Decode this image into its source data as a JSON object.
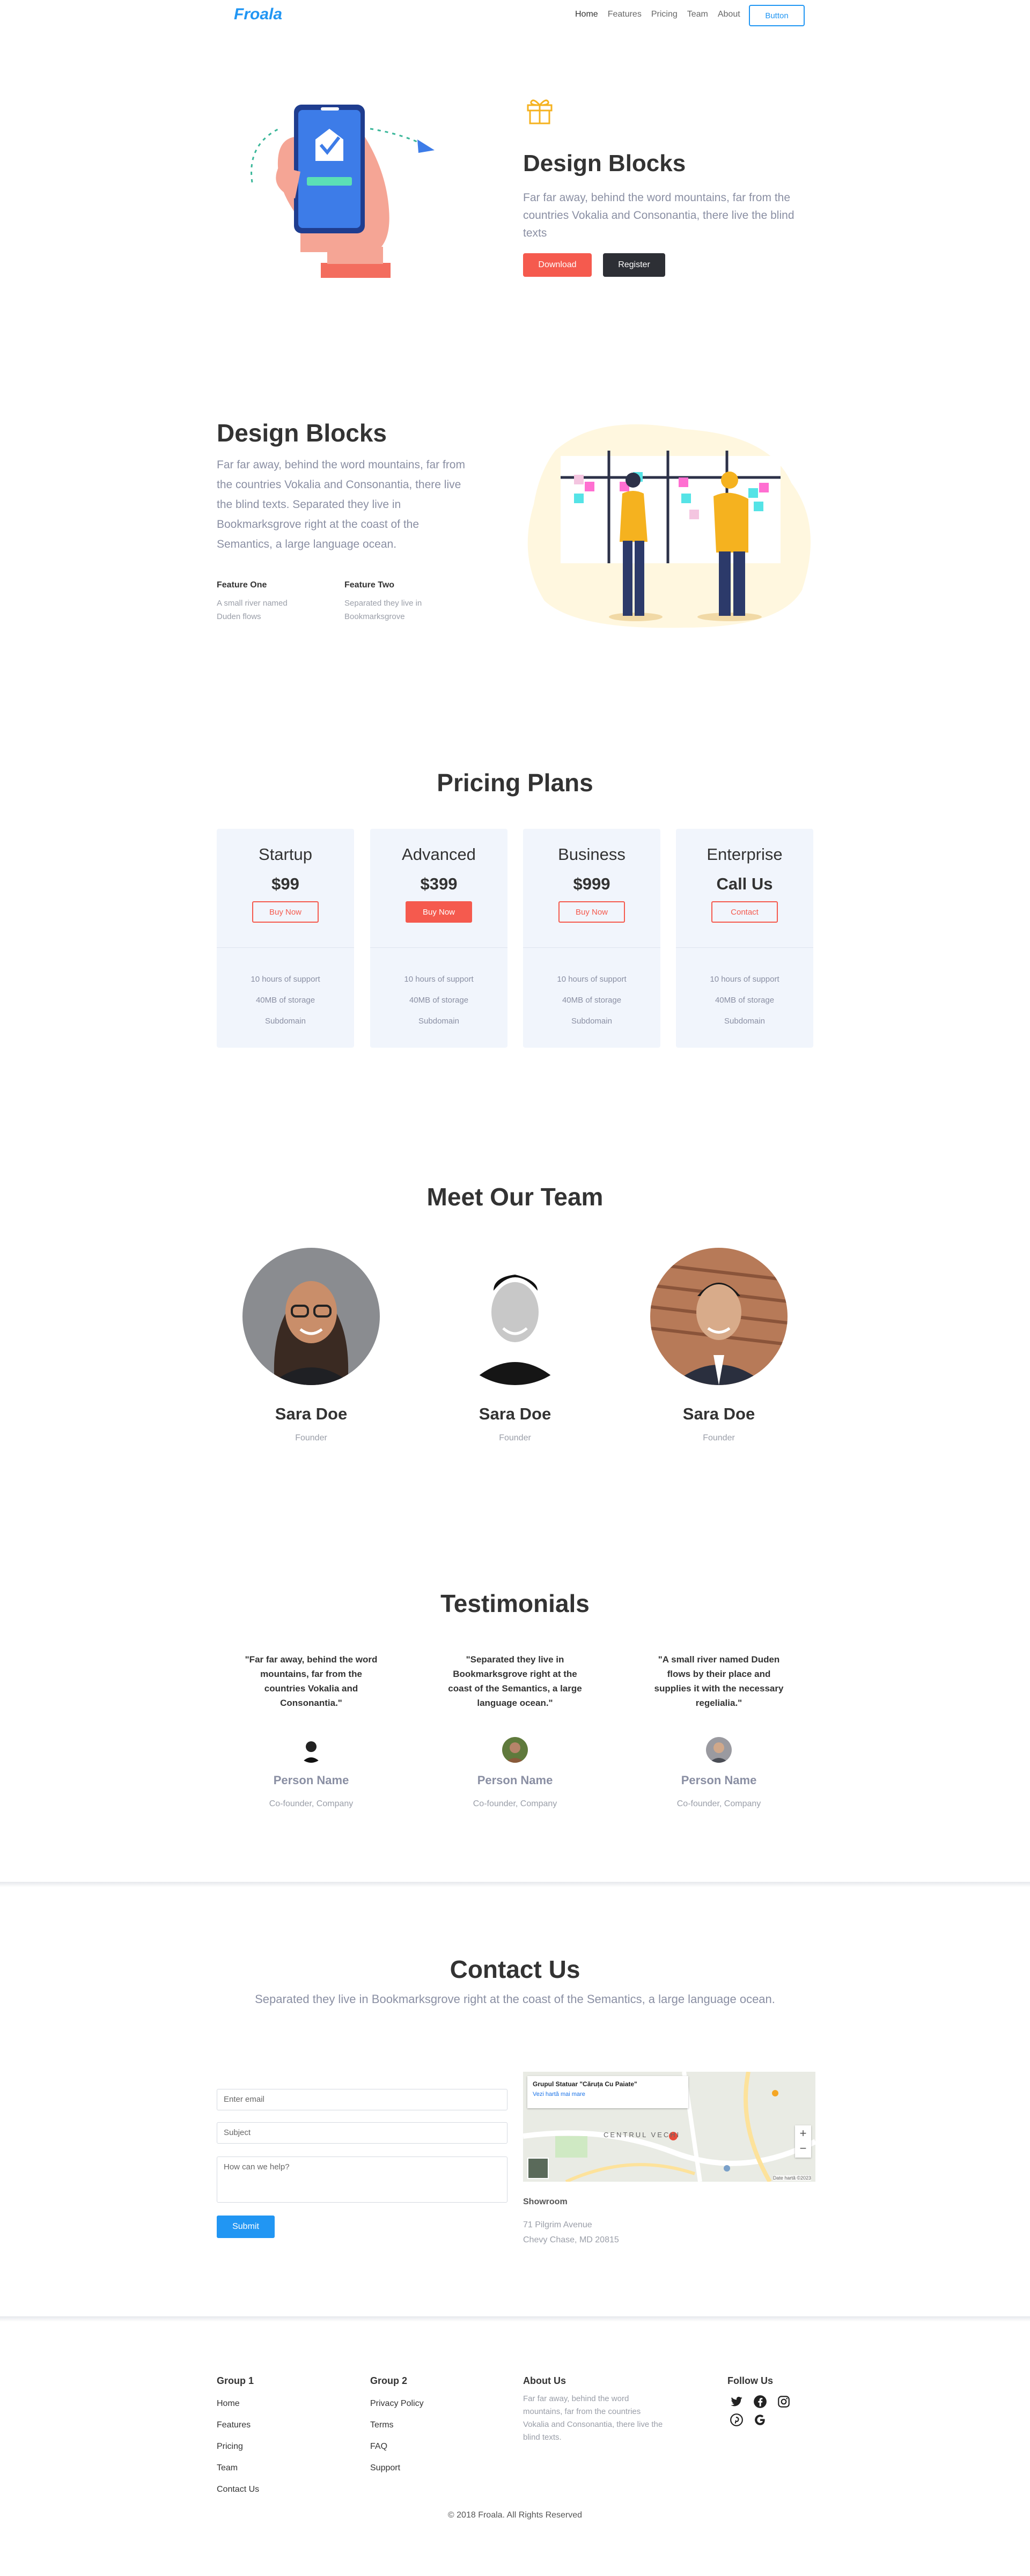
{
  "nav": {
    "logo": "Froala",
    "links": [
      "Home",
      "Features",
      "Pricing",
      "Team",
      "About"
    ],
    "button": "Button"
  },
  "hero": {
    "title": "Design Blocks",
    "text": "Far far away, behind the word mountains, far from the countries Vokalia and Consonantia, there live the blind texts",
    "download": "Download",
    "register": "Register"
  },
  "features": {
    "title": "Design Blocks",
    "text": "Far far away, behind the word mountains, far from the countries Vokalia and Consonantia, there live the blind texts. Separated they live in Bookmarksgrove right at the coast of the Semantics, a large language ocean.",
    "items": [
      {
        "title": "Feature One",
        "text": "A small river named Duden flows"
      },
      {
        "title": "Feature Two",
        "text": "Separated they live in Bookmarksgrove"
      }
    ]
  },
  "pricing": {
    "title": "Pricing Plans",
    "plans": [
      {
        "name": "Startup",
        "price": "$99",
        "button": "Buy Now",
        "features": [
          "10 hours of support",
          "40MB of storage",
          "Subdomain"
        ]
      },
      {
        "name": "Advanced",
        "price": "$399",
        "button": "Buy Now",
        "features": [
          "10 hours of support",
          "40MB of storage",
          "Subdomain"
        ]
      },
      {
        "name": "Business",
        "price": "$999",
        "button": "Buy Now",
        "features": [
          "10 hours of support",
          "40MB of storage",
          "Subdomain"
        ]
      },
      {
        "name": "Enterprise",
        "price": "Call Us",
        "button": "Contact",
        "features": [
          "10 hours of support",
          "40MB of storage",
          "Subdomain"
        ]
      }
    ]
  },
  "team": {
    "title": "Meet Our Team",
    "members": [
      {
        "name": "Sara Doe",
        "role": "Founder"
      },
      {
        "name": "Sara Doe",
        "role": "Founder"
      },
      {
        "name": "Sara Doe",
        "role": "Founder"
      }
    ]
  },
  "testimonials": {
    "title": "Testimonials",
    "items": [
      {
        "quote": "\"Far far away, behind the word mountains, far from the countries Vokalia and Consonantia.\"",
        "name": "Person Name",
        "role": "Co-founder, Company"
      },
      {
        "quote": "\"Separated they live in Bookmarksgrove right at the coast of the Semantics, a large language ocean.\"",
        "name": "Person Name",
        "role": "Co-founder, Company"
      },
      {
        "quote": "\"A small river named Duden flows by their place and supplies it with the necessary regelialia.\"",
        "name": "Person Name",
        "role": "Co-founder, Company"
      }
    ]
  },
  "contact": {
    "title": "Contact Us",
    "subtitle": "Separated they live in Bookmarksgrove right at the coast of the Semantics, a large language ocean.",
    "email_placeholder": "Enter email",
    "subject_placeholder": "Subject",
    "message_placeholder": "How can we help?",
    "submit": "Submit",
    "map": {
      "place_name": "Grupul Statuar \"Căruța Cu Paiate\"",
      "place_link": "Vezi hartă mai mare",
      "district": "CENTRUL VECHI",
      "attribution": "Date hartă ©2023"
    },
    "showroom_label": "Showroom",
    "address_line1": "71 Pilgrim Avenue",
    "address_line2": "Chevy Chase, MD 20815"
  },
  "footer": {
    "group1": {
      "title": "Group 1",
      "links": [
        "Home",
        "Features",
        "Pricing",
        "Team",
        "Contact Us"
      ]
    },
    "group2": {
      "title": "Group 2",
      "links": [
        "Privacy Policy",
        "Terms",
        "FAQ",
        "Support"
      ]
    },
    "about": {
      "title": "About Us",
      "text": "Far far away, behind the word mountains, far from the countries Vokalia and Consonantia, there live the blind texts."
    },
    "follow": {
      "title": "Follow Us",
      "icons": [
        "twitter-icon",
        "facebook-icon",
        "instagram-icon",
        "pinterest-icon",
        "google-icon"
      ]
    },
    "copyright": "© 2018 Froala. All Rights Reserved"
  },
  "colors": {
    "accent": "#f55a4e",
    "brand": "#2196f3",
    "dark": "#2d2f35",
    "card": "#f1f5fc"
  }
}
